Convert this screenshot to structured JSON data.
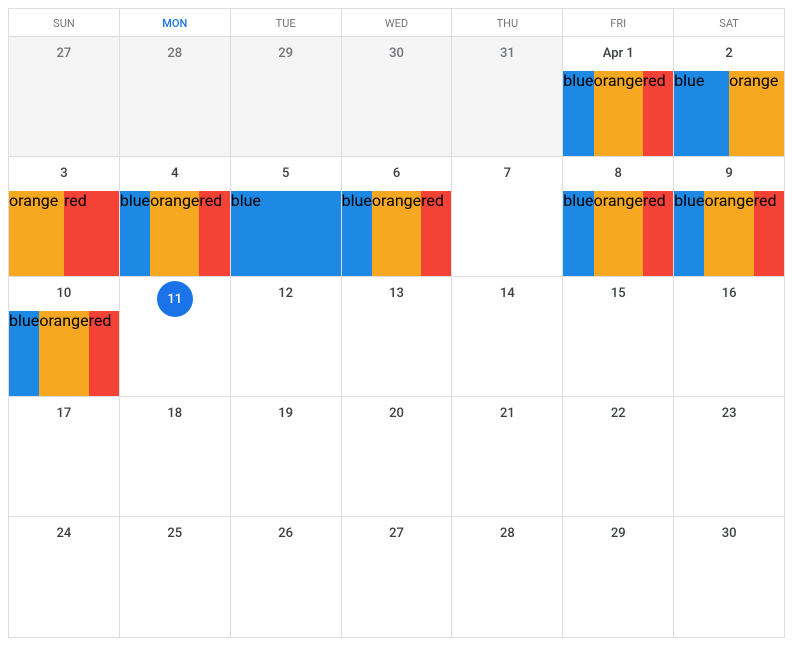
{
  "colors": {
    "blue": "#1e88e5",
    "orange": "#f6a821",
    "red": "#f44336"
  },
  "header": {
    "days": [
      "SUN",
      "MON",
      "TUE",
      "WED",
      "THU",
      "FRI",
      "SAT"
    ],
    "today_col_index": 1
  },
  "weeks": [
    [
      {
        "label": "27",
        "other_month": true,
        "today": false,
        "events": []
      },
      {
        "label": "28",
        "other_month": true,
        "today": false,
        "events": []
      },
      {
        "label": "29",
        "other_month": true,
        "today": false,
        "events": []
      },
      {
        "label": "30",
        "other_month": true,
        "today": false,
        "events": []
      },
      {
        "label": "31",
        "other_month": true,
        "today": false,
        "events": []
      },
      {
        "label": "Apr 1",
        "other_month": false,
        "today": false,
        "events": [
          "blue",
          "orange",
          "red"
        ]
      },
      {
        "label": "2",
        "other_month": false,
        "today": false,
        "events": [
          "blue",
          "orange"
        ]
      }
    ],
    [
      {
        "label": "3",
        "other_month": false,
        "today": false,
        "events": [
          "orange",
          "red"
        ]
      },
      {
        "label": "4",
        "other_month": false,
        "today": false,
        "events": [
          "blue",
          "orange",
          "red"
        ]
      },
      {
        "label": "5",
        "other_month": false,
        "today": false,
        "events": [
          "blue"
        ]
      },
      {
        "label": "6",
        "other_month": false,
        "today": false,
        "events": [
          "blue",
          "orange",
          "red"
        ]
      },
      {
        "label": "7",
        "other_month": false,
        "today": false,
        "events": []
      },
      {
        "label": "8",
        "other_month": false,
        "today": false,
        "events": [
          "blue",
          "orange",
          "red"
        ]
      },
      {
        "label": "9",
        "other_month": false,
        "today": false,
        "events": [
          "blue",
          "orange",
          "red"
        ]
      }
    ],
    [
      {
        "label": "10",
        "other_month": false,
        "today": false,
        "events": [
          "blue",
          "orange",
          "red"
        ]
      },
      {
        "label": "11",
        "other_month": false,
        "today": true,
        "events": []
      },
      {
        "label": "12",
        "other_month": false,
        "today": false,
        "events": []
      },
      {
        "label": "13",
        "other_month": false,
        "today": false,
        "events": []
      },
      {
        "label": "14",
        "other_month": false,
        "today": false,
        "events": []
      },
      {
        "label": "15",
        "other_month": false,
        "today": false,
        "events": []
      },
      {
        "label": "16",
        "other_month": false,
        "today": false,
        "events": []
      }
    ],
    [
      {
        "label": "17",
        "other_month": false,
        "today": false,
        "events": []
      },
      {
        "label": "18",
        "other_month": false,
        "today": false,
        "events": []
      },
      {
        "label": "19",
        "other_month": false,
        "today": false,
        "events": []
      },
      {
        "label": "20",
        "other_month": false,
        "today": false,
        "events": []
      },
      {
        "label": "21",
        "other_month": false,
        "today": false,
        "events": []
      },
      {
        "label": "22",
        "other_month": false,
        "today": false,
        "events": []
      },
      {
        "label": "23",
        "other_month": false,
        "today": false,
        "events": []
      }
    ],
    [
      {
        "label": "24",
        "other_month": false,
        "today": false,
        "events": []
      },
      {
        "label": "25",
        "other_month": false,
        "today": false,
        "events": []
      },
      {
        "label": "26",
        "other_month": false,
        "today": false,
        "events": []
      },
      {
        "label": "27",
        "other_month": false,
        "today": false,
        "events": []
      },
      {
        "label": "28",
        "other_month": false,
        "today": false,
        "events": []
      },
      {
        "label": "29",
        "other_month": false,
        "today": false,
        "events": []
      },
      {
        "label": "30",
        "other_month": false,
        "today": false,
        "events": []
      }
    ]
  ]
}
